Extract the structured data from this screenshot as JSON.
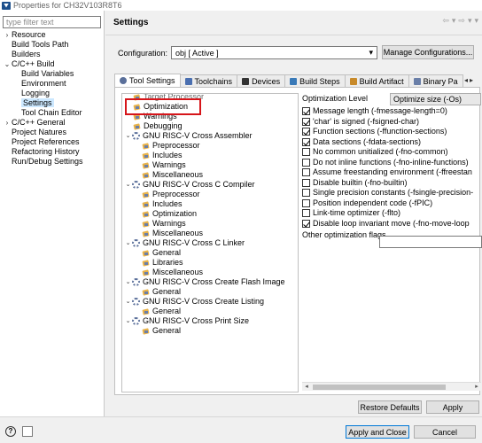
{
  "window": {
    "title": "Properties for CH32V103R8T6"
  },
  "filter": {
    "placeholder": "type filter text"
  },
  "nav": {
    "items": [
      {
        "label": "Resource",
        "chevron": "›",
        "indent": 0,
        "selected": false
      },
      {
        "label": "Build Tools Path",
        "chevron": "",
        "indent": 0,
        "selected": false
      },
      {
        "label": "Builders",
        "chevron": "",
        "indent": 0,
        "selected": false
      },
      {
        "label": "C/C++ Build",
        "chevron": "⌄",
        "indent": 0,
        "selected": false
      },
      {
        "label": "Build Variables",
        "chevron": "",
        "indent": 1,
        "selected": false
      },
      {
        "label": "Environment",
        "chevron": "",
        "indent": 1,
        "selected": false
      },
      {
        "label": "Logging",
        "chevron": "",
        "indent": 1,
        "selected": false
      },
      {
        "label": "Settings",
        "chevron": "",
        "indent": 1,
        "selected": true
      },
      {
        "label": "Tool Chain Editor",
        "chevron": "",
        "indent": 1,
        "selected": false
      },
      {
        "label": "C/C++ General",
        "chevron": "›",
        "indent": 0,
        "selected": false
      },
      {
        "label": "Project Natures",
        "chevron": "",
        "indent": 0,
        "selected": false
      },
      {
        "label": "Project References",
        "chevron": "",
        "indent": 0,
        "selected": false
      },
      {
        "label": "Refactoring History",
        "chevron": "",
        "indent": 0,
        "selected": false
      },
      {
        "label": "Run/Debug Settings",
        "chevron": "",
        "indent": 0,
        "selected": false
      }
    ]
  },
  "header": {
    "title": "Settings",
    "back_arrow": "⇦",
    "forward_arrow": "⇨",
    "menu_glyph": "▾"
  },
  "config": {
    "label": "Configuration:",
    "value": "obj  [ Active ]",
    "manage_label": "Manage Configurations..."
  },
  "tabs": [
    {
      "label": "Tool Settings",
      "icon": "gear-icon",
      "active": true
    },
    {
      "label": "Toolchains",
      "icon": "toolchain-icon",
      "active": false
    },
    {
      "label": "Devices",
      "icon": "devices-icon",
      "active": false
    },
    {
      "label": "Build Steps",
      "icon": "build-steps-icon",
      "active": false
    },
    {
      "label": "Build Artifact",
      "icon": "artifact-icon",
      "active": false
    },
    {
      "label": "Binary Pa",
      "icon": "binary-icon",
      "active": false
    }
  ],
  "tooltree": {
    "items": [
      {
        "label": "Target Processor",
        "indent": 1,
        "chevron": "",
        "type": "leaf",
        "partial": true
      },
      {
        "label": "Optimization",
        "indent": 1,
        "chevron": "",
        "type": "leaf",
        "selected": true
      },
      {
        "label": "Warnings",
        "indent": 1,
        "chevron": "",
        "type": "leaf"
      },
      {
        "label": "Debugging",
        "indent": 1,
        "chevron": "",
        "type": "leaf"
      },
      {
        "label": "GNU RISC-V Cross Assembler",
        "indent": 0,
        "chevron": "⌄",
        "type": "group"
      },
      {
        "label": "Preprocessor",
        "indent": 2,
        "chevron": "",
        "type": "leaf"
      },
      {
        "label": "Includes",
        "indent": 2,
        "chevron": "",
        "type": "leaf"
      },
      {
        "label": "Warnings",
        "indent": 2,
        "chevron": "",
        "type": "leaf"
      },
      {
        "label": "Miscellaneous",
        "indent": 2,
        "chevron": "",
        "type": "leaf"
      },
      {
        "label": "GNU RISC-V Cross C Compiler",
        "indent": 0,
        "chevron": "⌄",
        "type": "group"
      },
      {
        "label": "Preprocessor",
        "indent": 2,
        "chevron": "",
        "type": "leaf"
      },
      {
        "label": "Includes",
        "indent": 2,
        "chevron": "",
        "type": "leaf"
      },
      {
        "label": "Optimization",
        "indent": 2,
        "chevron": "",
        "type": "leaf"
      },
      {
        "label": "Warnings",
        "indent": 2,
        "chevron": "",
        "type": "leaf"
      },
      {
        "label": "Miscellaneous",
        "indent": 2,
        "chevron": "",
        "type": "leaf"
      },
      {
        "label": "GNU RISC-V Cross C Linker",
        "indent": 0,
        "chevron": "⌄",
        "type": "group"
      },
      {
        "label": "General",
        "indent": 2,
        "chevron": "",
        "type": "leaf"
      },
      {
        "label": "Libraries",
        "indent": 2,
        "chevron": "",
        "type": "leaf"
      },
      {
        "label": "Miscellaneous",
        "indent": 2,
        "chevron": "",
        "type": "leaf"
      },
      {
        "label": "GNU RISC-V Cross Create Flash Image",
        "indent": 0,
        "chevron": "⌄",
        "type": "group"
      },
      {
        "label": "General",
        "indent": 2,
        "chevron": "",
        "type": "leaf"
      },
      {
        "label": "GNU RISC-V Cross Create Listing",
        "indent": 0,
        "chevron": "⌄",
        "type": "group"
      },
      {
        "label": "General",
        "indent": 2,
        "chevron": "",
        "type": "leaf"
      },
      {
        "label": "GNU RISC-V Cross Print Size",
        "indent": 0,
        "chevron": "⌄",
        "type": "group"
      },
      {
        "label": "General",
        "indent": 2,
        "chevron": "",
        "type": "leaf"
      }
    ]
  },
  "optimization": {
    "level_label": "Optimization Level",
    "level_value": "Optimize size (-Os)",
    "options": [
      {
        "label": "Message length (-fmessage-length=0)",
        "checked": true
      },
      {
        "label": "'char' is signed (-fsigned-char)",
        "checked": true
      },
      {
        "label": "Function sections (-ffunction-sections)",
        "checked": true
      },
      {
        "label": "Data sections (-fdata-sections)",
        "checked": true
      },
      {
        "label": "No common unitialized (-fno-common)",
        "checked": false
      },
      {
        "label": "Do not inline functions (-fno-inline-functions)",
        "checked": false
      },
      {
        "label": "Assume freestanding environment (-ffreestan",
        "checked": false
      },
      {
        "label": "Disable builtin (-fno-builtin)",
        "checked": false
      },
      {
        "label": "Single precision constants (-fsingle-precision-",
        "checked": false
      },
      {
        "label": "Position independent code (-fPIC)",
        "checked": false
      },
      {
        "label": "Link-time optimizer (-flto)",
        "checked": false
      },
      {
        "label": "Disable loop invariant move (-fno-move-loop",
        "checked": true
      }
    ],
    "flags_label": "Other optimization flags",
    "flags_value": ""
  },
  "buttons": {
    "restore_defaults": "Restore Defaults",
    "apply": "Apply",
    "apply_close": "Apply and Close",
    "cancel": "Cancel"
  },
  "scroll": {
    "left_arrow": "◂",
    "right_arrow": "▸"
  },
  "colors": {
    "highlight_border": "#d6151a",
    "selection": "#cce8ff",
    "primary_border": "#0078d7"
  }
}
